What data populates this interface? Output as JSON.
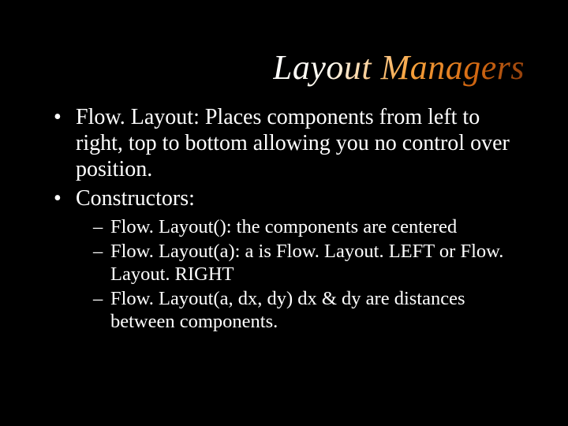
{
  "title": "Layout Managers",
  "bullets": {
    "b1": "Flow. Layout: Places components from left to right, top to bottom allowing you no control over position.",
    "b2": "Constructors:",
    "sub": {
      "s1": "Flow. Layout(): the components are centered",
      "s2": "Flow. Layout(a): a is Flow. Layout. LEFT or Flow. Layout. RIGHT",
      "s3": "Flow. Layout(a, dx, dy) dx & dy are distances between components."
    }
  }
}
